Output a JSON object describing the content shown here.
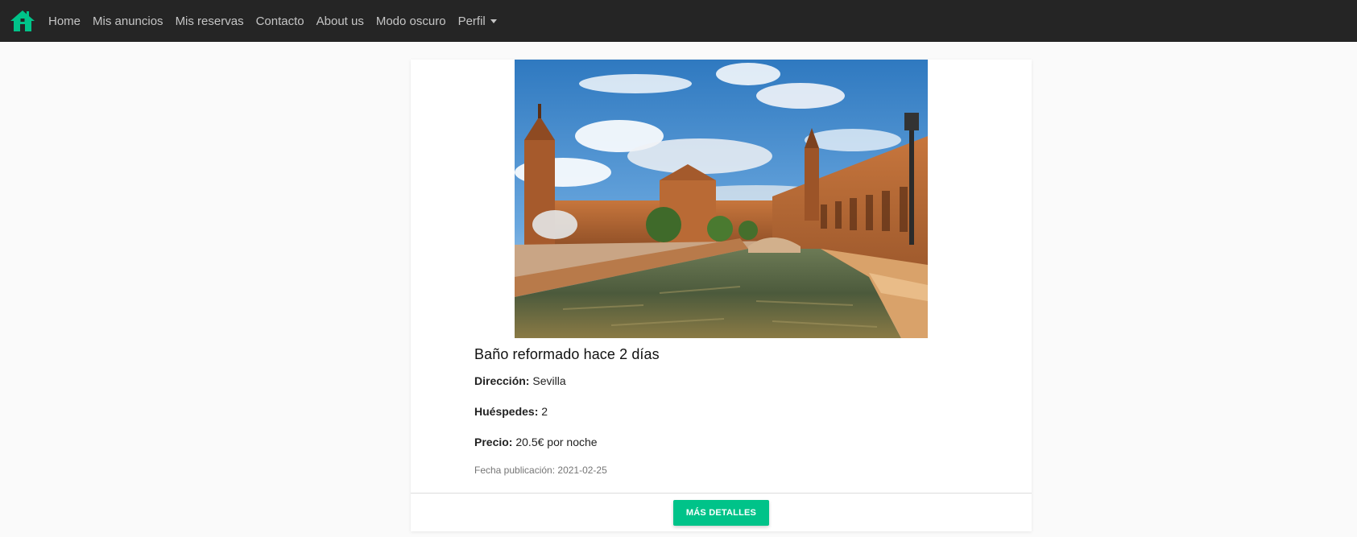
{
  "navbar": {
    "brand_icon": "home-icon",
    "brand_color": "#00c389",
    "links": [
      "Home",
      "Mis anuncios",
      "Mis reservas",
      "Contacto",
      "About us",
      "Modo oscuro"
    ],
    "profile": "Perfil"
  },
  "listing": {
    "title": "Baño reformado hace 2 días",
    "address_label": "Dirección:",
    "address": "Sevilla",
    "guests_label": "Huéspedes:",
    "guests": "2",
    "price_label": "Precio:",
    "price": "20.5€ por noche",
    "published": "Fecha publicación: 2021-02-25",
    "details_button": "MÁS DETALLES"
  },
  "colors": {
    "accent": "#00c389",
    "navbar_bg": "#252525"
  }
}
